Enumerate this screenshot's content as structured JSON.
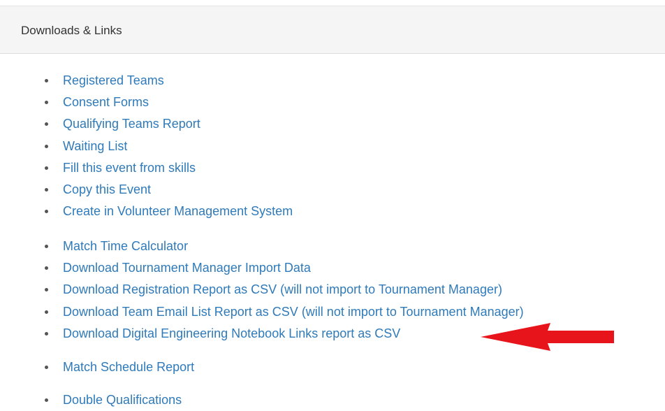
{
  "panel": {
    "title": "Downloads & Links"
  },
  "groups": [
    {
      "items": [
        {
          "label": "Registered Teams"
        },
        {
          "label": "Consent Forms"
        },
        {
          "label": "Qualifying Teams Report"
        },
        {
          "label": "Waiting List"
        },
        {
          "label": "Fill this event from skills"
        },
        {
          "label": "Copy this Event"
        },
        {
          "label": "Create in Volunteer Management System"
        }
      ]
    },
    {
      "items": [
        {
          "label": "Match Time Calculator"
        },
        {
          "label": "Download Tournament Manager Import Data"
        },
        {
          "label": "Download Registration Report as CSV (will not import to Tournament Manager)"
        },
        {
          "label": "Download Team Email List Report as CSV (will not import to Tournament Manager)"
        },
        {
          "label": "Download Digital Engineering Notebook Links report as CSV"
        }
      ]
    },
    {
      "items": [
        {
          "label": "Match Schedule Report"
        }
      ]
    },
    {
      "items": [
        {
          "label": "Double Qualifications"
        }
      ]
    }
  ],
  "annotation": {
    "icon": "left-arrow-icon",
    "color": "#e8141b"
  },
  "colors": {
    "link": "#2f7ab9",
    "heading_bg": "#f5f5f5",
    "text": "#333333"
  }
}
